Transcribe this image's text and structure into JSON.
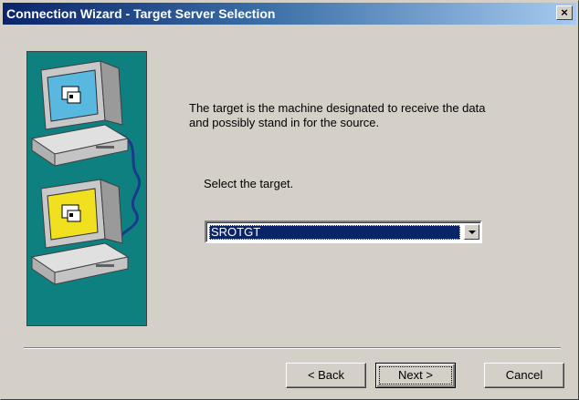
{
  "window": {
    "title": "Connection Wizard - Target Server Selection",
    "close_label": "✕"
  },
  "content": {
    "description_line1": "The target is the machine designated to receive the data",
    "description_line2": "and possibly stand in for the source.",
    "select_label": "Select the target.",
    "target_combo": {
      "selected_value": "SROTGT"
    }
  },
  "buttons": {
    "back_label": "< Back",
    "next_label": "Next >",
    "cancel_label": "Cancel"
  },
  "colors": {
    "title_gradient_start": "#0a246a",
    "title_gradient_end": "#a6caf0",
    "dialog_face": "#d4d0c8",
    "art_background": "#0f8080",
    "selection": "#0a246a"
  },
  "icons": {
    "source_computer": "source-computer-icon",
    "target_computer": "target-computer-icon"
  }
}
